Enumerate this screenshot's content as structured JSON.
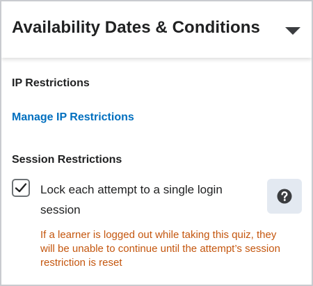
{
  "panel": {
    "title": "Availability Dates & Conditions",
    "toggle_icon": "caret-down-icon"
  },
  "ip_restrictions": {
    "heading": "IP Restrictions",
    "link_label": "Manage IP Restrictions"
  },
  "session_restrictions": {
    "heading": "Session Restrictions",
    "checkbox_label": "Lock each attempt to a single login session",
    "checked": true,
    "help_icon": "question-circle-icon",
    "warning": "If a learner is logged out while taking this quiz, they will be unable to continue until the attempt’s session restriction is reset"
  },
  "colors": {
    "text": "#202122",
    "link": "#006fbf",
    "warning": "#c4560e",
    "help_button_bg": "#e3e9f1"
  }
}
